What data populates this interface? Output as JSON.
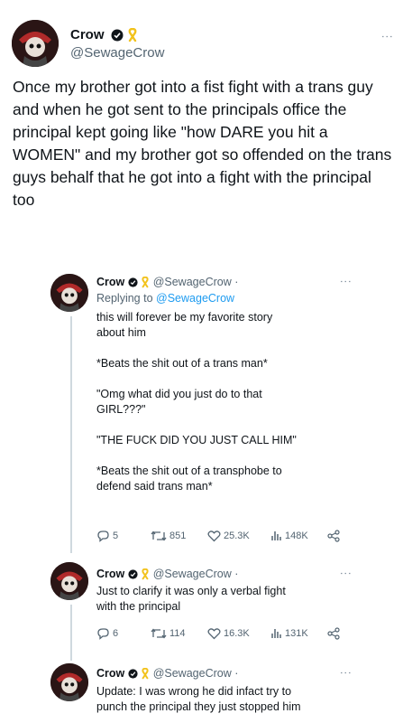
{
  "main_tweet": {
    "name": "Crow",
    "handle": "@SewageCrow",
    "text": "Once my brother got into a fist fight with a trans guy and when he got sent to the principals office the principal kept going like \"how DARE you hit a WOMEN\" and my brother got so offended on the trans guys behalf that he got into a fight with the principal too"
  },
  "replies": [
    {
      "name": "Crow",
      "handle": "@SewageCrow",
      "separator": "·",
      "replying_prefix": "Replying to",
      "replying_to": "@SewageCrow",
      "text": "this will forever be my favorite story\nabout him\n\n*Beats the shit out of a trans man*\n\n\"Omg what did you just do to that\nGIRL???\"\n\n\"THE FUCK DID YOU JUST CALL HIM\"\n\n*Beats the shit out of a transphobe to\ndefend said trans man*",
      "stats": {
        "replies": "5",
        "retweets": "851",
        "likes": "25.3K",
        "views": "148K"
      }
    },
    {
      "name": "Crow",
      "handle": "@SewageCrow",
      "separator": "·",
      "text": "Just to clarify it was only a verbal fight\nwith the principal",
      "stats": {
        "replies": "6",
        "retweets": "114",
        "likes": "16.3K",
        "views": "131K"
      }
    },
    {
      "name": "Crow",
      "handle": "@SewageCrow",
      "separator": "·",
      "text": "Update: I was wrong he did infact try to\npunch the principal they just stopped him"
    }
  ],
  "icons": {
    "more": "more-options-icon",
    "verified": "verified-badge-icon",
    "ribbon": "yellow-ribbon-icon",
    "reply": "reply-icon",
    "retweet": "retweet-icon",
    "like": "heart-icon",
    "views": "views-bar-icon",
    "share": "share-icon"
  },
  "colors": {
    "ribbon": "#f2c21b",
    "link": "#1d9bf0",
    "muted": "#536471",
    "line": "#cfd9de"
  }
}
